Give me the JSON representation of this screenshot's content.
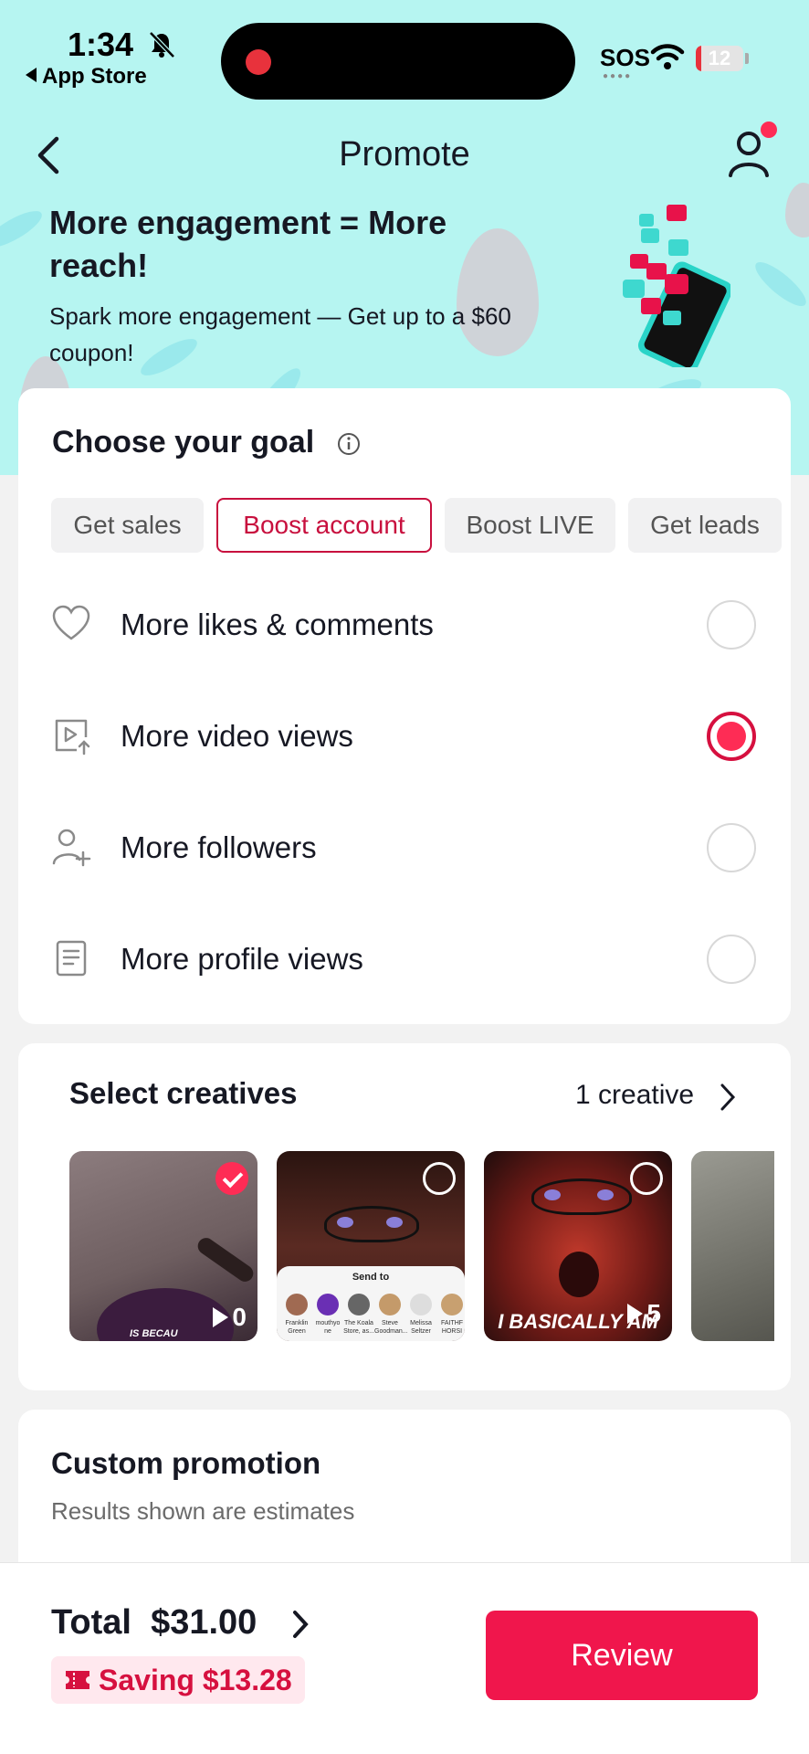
{
  "status_bar": {
    "time": "1:34",
    "back_app": "App Store",
    "carrier": "SOS",
    "battery": "12",
    "battery_level": 0.12
  },
  "nav": {
    "title": "Promote"
  },
  "promo": {
    "title": "More engagement = More reach!",
    "subtitle": "Spark more engagement — Get up to a $60 coupon!"
  },
  "goal": {
    "title": "Choose your goal",
    "tabs": [
      {
        "label": "Get sales",
        "active": false
      },
      {
        "label": "Boost account",
        "active": true
      },
      {
        "label": "Boost LIVE",
        "active": false
      },
      {
        "label": "Get leads",
        "active": false
      }
    ],
    "options": [
      {
        "label": "More likes & comments",
        "icon": "heart-icon",
        "selected": false
      },
      {
        "label": "More video views",
        "icon": "video-views-icon",
        "selected": true
      },
      {
        "label": "More followers",
        "icon": "add-follower-icon",
        "selected": false
      },
      {
        "label": "More profile views",
        "icon": "profile-document-icon",
        "selected": false
      }
    ]
  },
  "creatives": {
    "title": "Select creatives",
    "count": "1 creative",
    "thumbs": [
      {
        "views": "0",
        "selected": true,
        "caption": "IS BECAU"
      },
      {
        "views": "",
        "selected": false,
        "caption": "",
        "share_title": "Send to",
        "share_names": [
          "Franklin Green",
          "mouthyo ne",
          "The Koala Store, as...",
          "Steve Goodman...",
          "Melissa Seltzer",
          "FAITHF HORSI"
        ]
      },
      {
        "views": "5",
        "selected": false,
        "caption": "I BASICALLY AM"
      },
      {
        "views": "",
        "selected": false,
        "caption": ""
      }
    ]
  },
  "custom": {
    "title": "Custom promotion",
    "subtitle": "Results shown are estimates"
  },
  "footer": {
    "total_label": "Total",
    "total_value": "$31.00",
    "total_text": "Total  $31.00",
    "saving": "Saving $13.28",
    "review": "Review"
  },
  "colors": {
    "accent": "#fe2c55",
    "accent_dark": "#d6103f",
    "hero_bg": "#b6f5f1"
  }
}
